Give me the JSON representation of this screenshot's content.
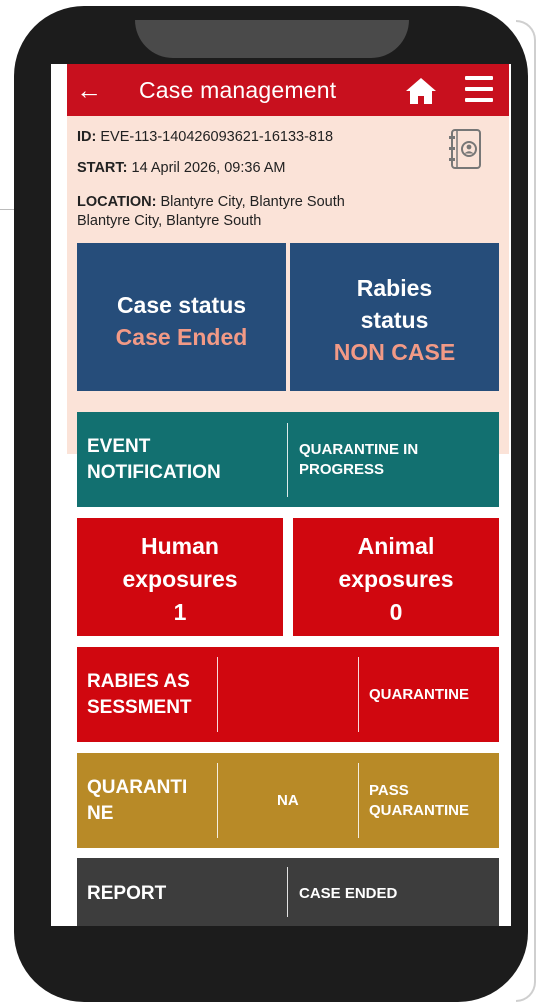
{
  "header": {
    "title": "Case management",
    "back_icon": "back-arrow-icon",
    "home_icon": "home-icon",
    "menu_icon": "hamburger-menu-icon"
  },
  "case_info": {
    "id_label": "ID:",
    "id_value": "EVE-113-140426093621-16133-818",
    "start_label": "START:",
    "start_value": "14 April 2026, 09:36 AM",
    "location_label": "LOCATION:",
    "location_value": "Blantyre City, Blantyre South",
    "location_value_2": "Blantyre City, Blantyre South",
    "contact_icon": "contact-book-icon"
  },
  "status_tiles": {
    "case_status_title": "Case status",
    "case_status_value": "Case Ended",
    "rabies_status_title_1": "Rabies",
    "rabies_status_title_2": "status",
    "rabies_status_value": "NON CASE"
  },
  "event_notification": {
    "label_1": "EVENT",
    "label_2": "NOTIFICATION",
    "value_1": "QUARANTINE IN",
    "value_2": "PROGRESS"
  },
  "exposures": {
    "human_1": "Human",
    "human_2": "exposures",
    "human_count": "1",
    "animal_1": "Animal",
    "animal_2": "exposures",
    "animal_count": "0"
  },
  "rabies_assessment": {
    "label_1": "RABIES AS",
    "label_2": "SESSMENT",
    "value": "QUARANTINE"
  },
  "quarantine": {
    "label_1": "QUARANTI",
    "label_2": "NE",
    "middle_value": "NA",
    "value_1": "PASS",
    "value_2": "QUARANTINE"
  },
  "report": {
    "label": "REPORT",
    "value": "CASE ENDED"
  },
  "colors": {
    "header_red": "#c8101e",
    "info_bg": "#fbe3d8",
    "status_blue": "#264d7a",
    "status_value_pink": "#f29a86",
    "event_teal": "#127070",
    "exposure_red": "#d0070f",
    "quarantine_gold": "#b88a27",
    "report_dark": "#3d3d3d"
  }
}
